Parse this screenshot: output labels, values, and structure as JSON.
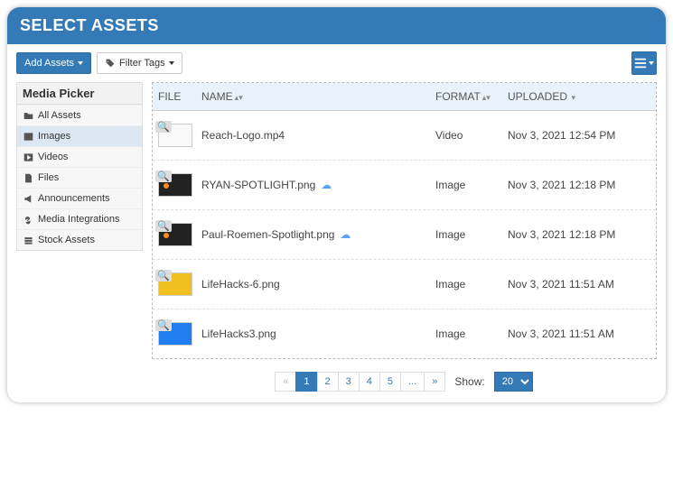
{
  "header": {
    "title": "SELECT ASSETS"
  },
  "toolbar": {
    "add_assets_label": "Add Assets",
    "filter_tags_label": "Filter Tags"
  },
  "sidebar": {
    "title": "Media Picker",
    "items": [
      {
        "label": "All Assets",
        "icon": "folder-icon",
        "active": false
      },
      {
        "label": "Images",
        "icon": "image-icon",
        "active": true
      },
      {
        "label": "Videos",
        "icon": "play-icon",
        "active": false
      },
      {
        "label": "Files",
        "icon": "file-icon",
        "active": false
      },
      {
        "label": "Announcements",
        "icon": "megaphone-icon",
        "active": false
      },
      {
        "label": "Media Integrations",
        "icon": "link-icon",
        "active": false
      },
      {
        "label": "Stock Assets",
        "icon": "stack-icon",
        "active": false
      }
    ]
  },
  "table": {
    "columns": {
      "file": "FILE",
      "name": "NAME",
      "format": "FORMAT",
      "uploaded": "UPLOADED"
    },
    "rows": [
      {
        "name": "Reach-Logo.mp4",
        "format": "Video",
        "uploaded": "Nov 3, 2021 12:54 PM",
        "thumb": "white",
        "cloud": false
      },
      {
        "name": "RYAN-SPOTLIGHT.png",
        "format": "Image",
        "uploaded": "Nov 3, 2021 12:18 PM",
        "thumb": "dark",
        "cloud": true
      },
      {
        "name": "Paul-Roemen-Spotlight.png",
        "format": "Image",
        "uploaded": "Nov 3, 2021 12:18 PM",
        "thumb": "dark",
        "cloud": true
      },
      {
        "name": "LifeHacks-6.png",
        "format": "Image",
        "uploaded": "Nov 3, 2021 11:51 AM",
        "thumb": "yellow",
        "cloud": false
      },
      {
        "name": "LifeHacks3.png",
        "format": "Image",
        "uploaded": "Nov 3, 2021 11:51 AM",
        "thumb": "blue",
        "cloud": false
      }
    ]
  },
  "pager": {
    "prev": "«",
    "next": "»",
    "pages": [
      "1",
      "2",
      "3",
      "4",
      "5",
      "..."
    ],
    "active_index": 0,
    "show_label": "Show:",
    "show_value": "20"
  }
}
